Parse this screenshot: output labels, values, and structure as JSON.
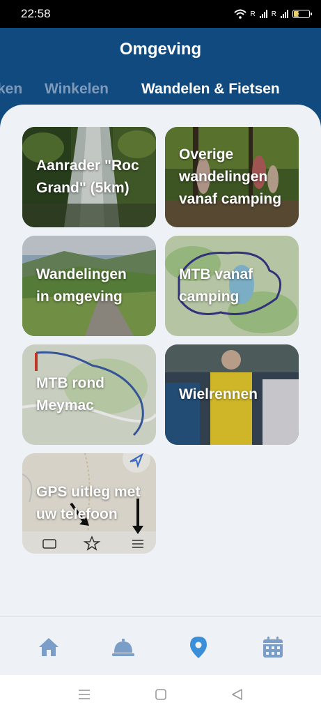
{
  "status": {
    "time": "22:58",
    "battery": "31",
    "battery_level": 0.31
  },
  "header": {
    "title": "Omgeving"
  },
  "tabs": [
    {
      "label": "ken"
    },
    {
      "label": "Winkelen"
    },
    {
      "label": "Wandelen & Fietsen"
    }
  ],
  "cards": [
    {
      "label": "Aanrader \"Roc\nGrand\"  (5km)"
    },
    {
      "label": "Overige\nwandelingen\nvanaf camping"
    },
    {
      "label": "Wandelingen\nin omgeving"
    },
    {
      "label": "MTB vanaf\ncamping"
    },
    {
      "label": "MTB rond\nMeymac"
    },
    {
      "label": "Wielrennen"
    },
    {
      "label": "GPS uitleg met\nuw telefoon"
    }
  ],
  "bottom_nav": [
    {
      "icon": "home-icon"
    },
    {
      "icon": "reception-bell-icon"
    },
    {
      "icon": "map-pin-icon",
      "active": true
    },
    {
      "icon": "calendar-icon"
    }
  ],
  "colors": {
    "header_bg": "#104a7f",
    "content_bg": "#eef2f7",
    "tab_active": "#ffffff",
    "tab_inactive": "#7f9ab9",
    "nav_icon": "#7a9ec8",
    "nav_icon_active": "#3a8fd8"
  }
}
